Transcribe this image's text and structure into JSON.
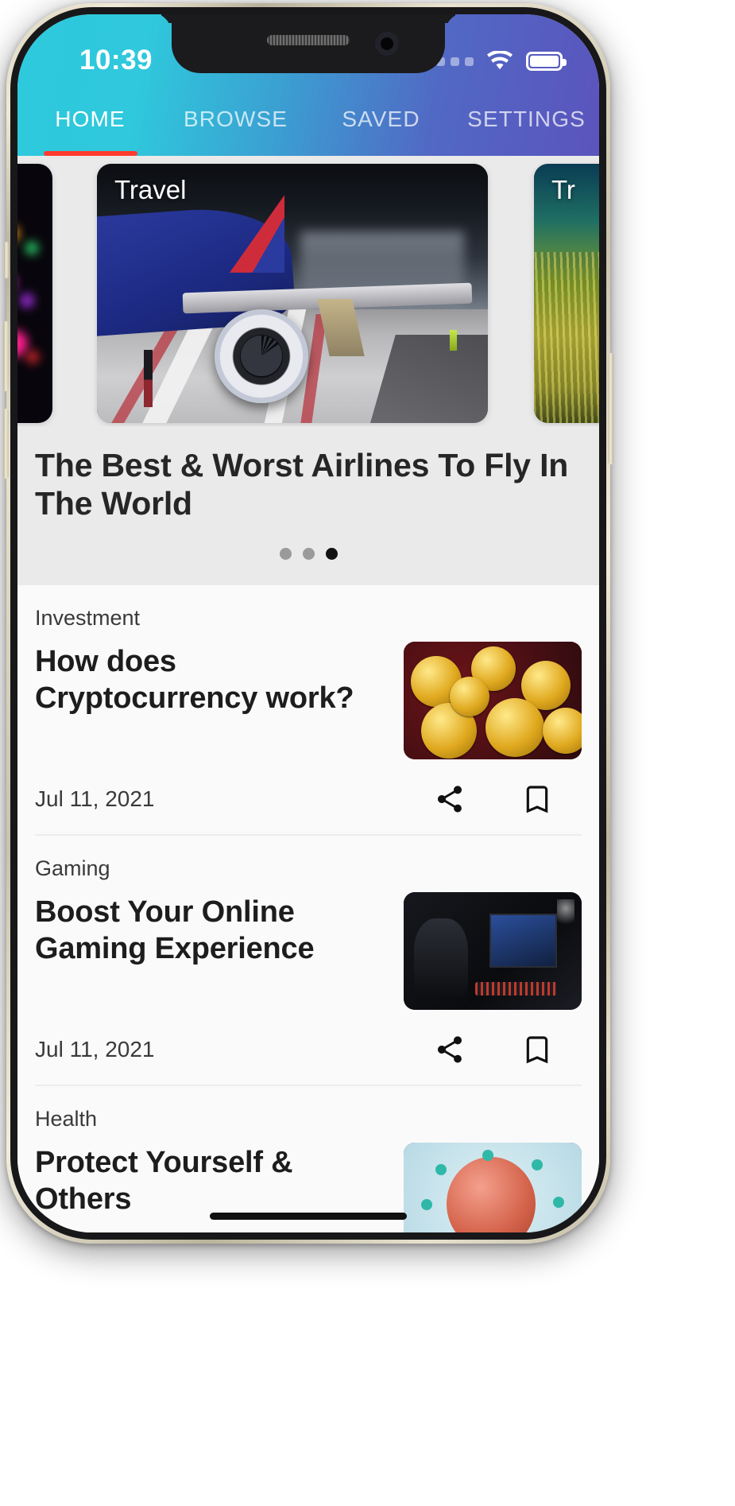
{
  "status_bar": {
    "time": "10:39",
    "signal_icon": "signal-dots-icon",
    "wifi_icon": "wifi-icon",
    "battery_icon": "battery-full-icon"
  },
  "tabs": [
    {
      "label": "HOME",
      "active": true
    },
    {
      "label": "BROWSE",
      "active": false
    },
    {
      "label": "SAVED",
      "active": false
    },
    {
      "label": "SETTINGS",
      "active": false
    }
  ],
  "colors": {
    "gradient_start": "#2ec9dd",
    "gradient_end": "#5b54bd",
    "tab_indicator": "#ff3b2f",
    "hero_background": "#eaeaea",
    "list_background": "#fafafa",
    "active_dot": "#121212",
    "inactive_dot": "#9a9a9a"
  },
  "hero": {
    "category_current": "Travel",
    "category_next": "Tr",
    "title": "The Best & Worst Airlines To Fly In The World",
    "pagination": {
      "total": 3,
      "active_index": 2
    }
  },
  "articles": [
    {
      "category": "Investment",
      "title": "How does Cryptocurrency work?",
      "date": "Jul 11, 2021",
      "share_icon": "share-icon",
      "bookmark_icon": "bookmark-icon",
      "thumb": "bitcoin-coins-image"
    },
    {
      "category": "Gaming",
      "title": "Boost Your Online Gaming Experience",
      "date": "Jul 11, 2021",
      "share_icon": "share-icon",
      "bookmark_icon": "bookmark-icon",
      "thumb": "gaming-setup-image"
    },
    {
      "category": "Health",
      "title": "Protect Yourself & Others",
      "date": "",
      "share_icon": "share-icon",
      "bookmark_icon": "bookmark-icon",
      "thumb": "virus-image"
    }
  ]
}
